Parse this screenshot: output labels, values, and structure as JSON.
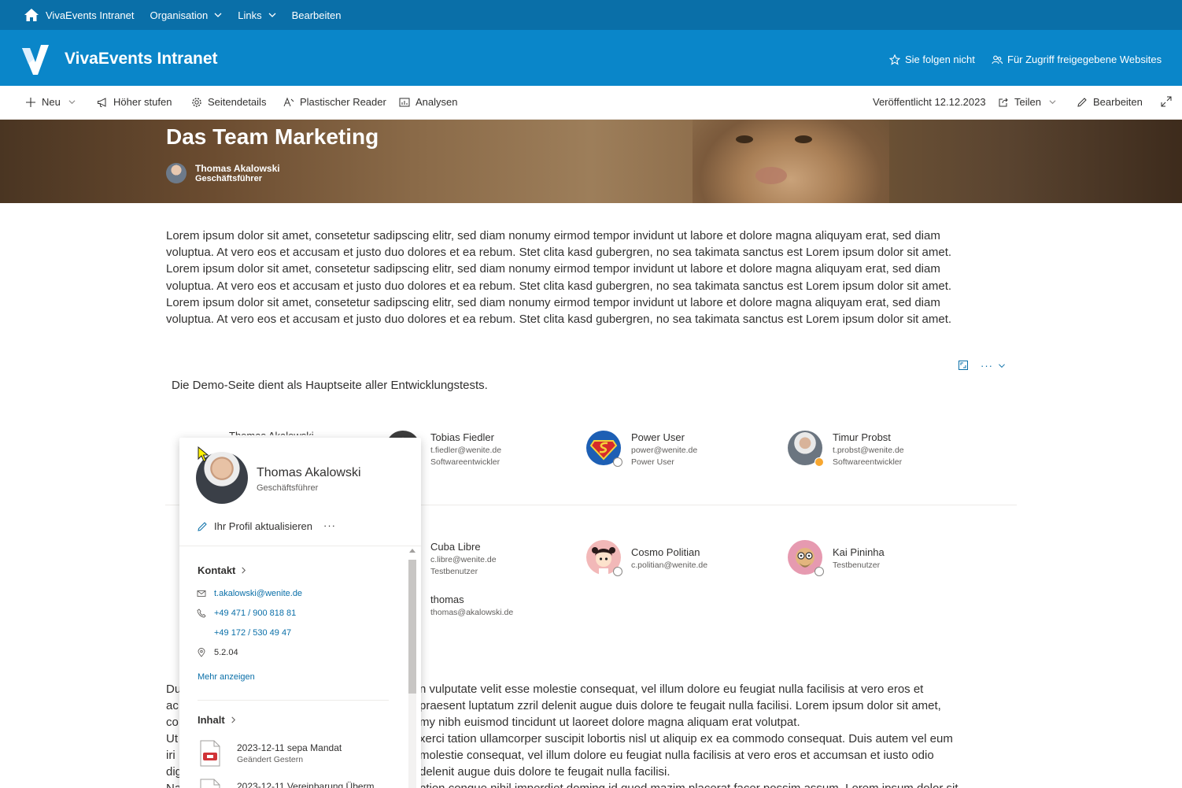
{
  "suitebar": {
    "site_link": "VivaEvents Intranet",
    "nav": [
      "Organisation",
      "Links",
      "Bearbeiten"
    ]
  },
  "header": {
    "title": "VivaEvents Intranet",
    "follow_label": "Sie folgen nicht",
    "shared_label": "Für Zugriff freigegebene Websites",
    "brand_color": "#0a86c9",
    "suite_color": "#0a6fa8"
  },
  "commandbar": {
    "new_label": "Neu",
    "promote_label": "Höher stufen",
    "details_label": "Seitendetails",
    "reader_label": "Plastischer Reader",
    "analytics_label": "Analysen",
    "published_label": "Veröffentlicht 12.12.2023",
    "share_label": "Teilen",
    "edit_label": "Bearbeiten"
  },
  "hero": {
    "title": "Das Team Marketing",
    "author_name": "Thomas Akalowski",
    "author_role": "Geschäftsführer"
  },
  "content": {
    "lorem_lines": [
      "Lorem ipsum dolor sit amet, consetetur sadipscing elitr, sed diam nonumy eirmod tempor invidunt ut labore et dolore magna aliquyam erat, sed diam",
      "voluptua. At vero eos et accusam et justo duo dolores et ea rebum. Stet clita kasd gubergren, no sea takimata sanctus est Lorem ipsum dolor sit amet.",
      "Lorem ipsum dolor sit amet, consetetur sadipscing elitr, sed diam nonumy eirmod tempor invidunt ut labore et dolore magna aliquyam erat, sed diam",
      "voluptua. At vero eos et accusam et justo duo dolores et ea rebum. Stet clita kasd gubergren, no sea takimata sanctus est Lorem ipsum dolor sit amet.",
      "Lorem ipsum dolor sit amet, consetetur sadipscing elitr, sed diam nonumy eirmod tempor invidunt ut labore et dolore magna aliquyam erat, sed diam",
      "voluptua. At vero eos et accusam et justo duo dolores et ea rebum. Stet clita kasd gubergren, no sea takimata sanctus est Lorem ipsum dolor sit amet."
    ],
    "demo_text": "Die Demo-Seite dient als Hauptseite aller Entwicklungstests.",
    "lorem2_left": [
      "Du",
      "ac",
      "co",
      "Ut",
      "iri",
      "dig",
      "Na"
    ],
    "lorem2_right": [
      "n vulputate velit esse molestie consequat, vel illum dolore eu feugiat nulla facilisis at vero eros et",
      "praesent luptatum zzril delenit augue duis dolore te feugait nulla facilisi. Lorem ipsum dolor sit amet,",
      "my nibh euismod tincidunt ut laoreet dolore magna aliquam erat volutpat.",
      "xerci tation ullamcorper suscipit lobortis nisl ut aliquip ex ea commodo consequat. Duis autem vel eum",
      "molestie consequat, vel illum dolore eu feugiat nulla facilisis at vero eros et accumsan et iusto odio",
      "delenit augue duis dolore te feugait nulla facilisi.",
      "ption congue nihil imperdiet doming id quod mazim placerat facer possim assum. Lorem ipsum dolor sit"
    ]
  },
  "people": {
    "behind_card_name": "Thomas Akalowski",
    "list": [
      {
        "name": "Tobias Fiedler",
        "email": "t.fiedler@wenite.de",
        "role": "Softwareentwickler"
      },
      {
        "name": "Power User",
        "email": "power@wenite.de",
        "role": "Power User"
      },
      {
        "name": "Timur Probst",
        "email": "t.probst@wenite.de",
        "role": "Softwareentwickler"
      },
      {
        "name": "Cuba Libre",
        "email": "c.libre@wenite.de",
        "role": "Testbenutzer"
      },
      {
        "name": "Cosmo Politian",
        "email": "c.politian@wenite.de",
        "role": ""
      },
      {
        "name": "Kai Pininha",
        "email": "",
        "role": "Testbenutzer"
      },
      {
        "name": "thomas",
        "email": "thomas@akalowski.de",
        "role": ""
      }
    ]
  },
  "profile_card": {
    "name": "Thomas Akalowski",
    "role": "Geschäftsführer",
    "update_label": "Ihr Profil aktualisieren",
    "more_dots": "···",
    "contact_heading": "Kontakt",
    "email": "t.akalowski@wenite.de",
    "phone1": "+49 471 / 900 818 81",
    "phone2": "+49 172 / 530 49 47",
    "office": "5.2.04",
    "show_more": "Mehr anzeigen",
    "content_heading": "Inhalt",
    "files": [
      {
        "title": "2023-12-11 sepa Mandat",
        "subtitle": "Geändert Gestern"
      },
      {
        "title": "2023-12-11 Vereinbarung Überm",
        "subtitle": ""
      }
    ]
  },
  "icons": {
    "home": "home-icon",
    "star": "star-icon",
    "people": "people-icon",
    "plus": "plus-icon",
    "megaphone": "megaphone-icon",
    "gear": "gear-icon",
    "reader": "reader-icon",
    "chart": "chart-icon",
    "share": "share-icon",
    "pencil": "pencil-icon",
    "expand": "expand-icon",
    "mail": "mail-icon",
    "phone": "phone-icon",
    "location": "location-icon",
    "pdf": "pdf-file-icon"
  }
}
